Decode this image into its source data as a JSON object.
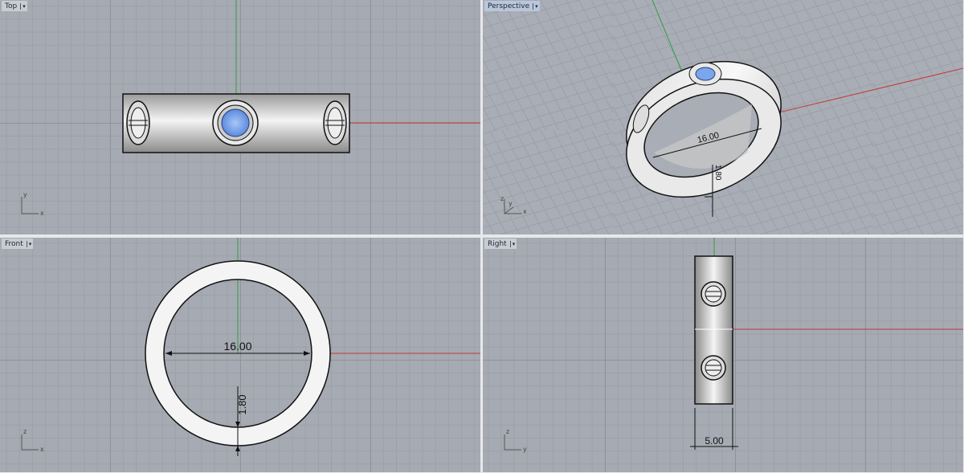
{
  "viewports": {
    "top": {
      "label": "Top",
      "axis_a": "y",
      "axis_b": "x"
    },
    "perspective": {
      "label": "Perspective",
      "axis_a": "z",
      "axis_b": "y",
      "axis_c": "x",
      "dim_diameter": "16.00",
      "dim_thickness": "1.80"
    },
    "front": {
      "label": "Front",
      "axis_a": "z",
      "axis_b": "x",
      "dim_diameter": "16.00",
      "dim_thickness": "1.80"
    },
    "right": {
      "label": "Right",
      "axis_a": "z",
      "axis_b": "y",
      "dim_width": "5.00"
    }
  },
  "menu_caret": "▾",
  "colors": {
    "x_axis": "#c0393b",
    "y_axis": "#2ea043",
    "gem": "#7aa6ee",
    "grid": "#a6aab2"
  }
}
